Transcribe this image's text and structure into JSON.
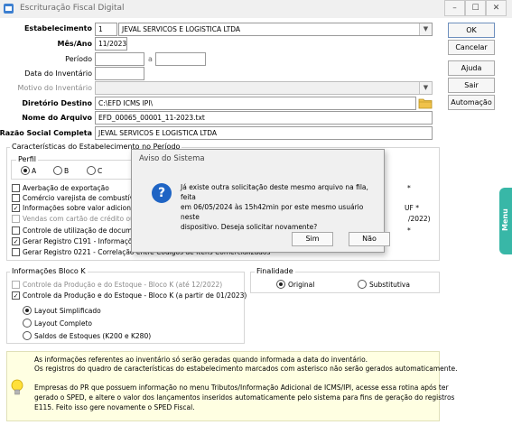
{
  "window": {
    "title": "Escrituração Fiscal Digital",
    "min_glyph": "–",
    "max_glyph": "☐",
    "close_glyph": "✕"
  },
  "form": {
    "estabelecimento": {
      "label": "Estabelecimento",
      "code": "1",
      "name": "JEVAL SERVICOS E LOGISTICA LTDA"
    },
    "mes_ano": {
      "label": "Mês/Ano",
      "value": "11/2023"
    },
    "periodo": {
      "label": "Período",
      "from": "",
      "separator": "a",
      "to": ""
    },
    "data_inventario": {
      "label": "Data do Inventário",
      "value": ""
    },
    "motivo_inventario": {
      "label": "Motivo do Inventário",
      "value": ""
    },
    "diretorio_destino": {
      "label": "Diretório Destino",
      "value": "C:\\EFD ICMS IPI\\"
    },
    "nome_arquivo": {
      "label": "Nome do Arquivo",
      "value": "EFD_00065_00001_11-2023.txt"
    },
    "razao_social": {
      "label": "Razão Social Completa",
      "value": "JEVAL SERVICOS E LOGISTICA LTDA"
    }
  },
  "buttons": {
    "ok": "OK",
    "cancelar": "Cancelar",
    "ajuda": "Ajuda",
    "sair": "Sair",
    "automacao": "Automação"
  },
  "caracteristicas": {
    "title": "Características do Estabelecimento no Período",
    "perfil": {
      "title": "Perfil",
      "options": [
        "A",
        "B",
        "C"
      ],
      "selected": "A"
    },
    "items": [
      {
        "label": "Averbação de exportação",
        "checked": false,
        "disabled": false
      },
      {
        "label": "Comércio varejista de combustíveis",
        "checked": false,
        "disabled": false
      },
      {
        "label": "Informações sobre valor adicionado",
        "checked": true,
        "disabled": false
      },
      {
        "label": "Vendas com cartão de crédito ou de",
        "checked": false,
        "disabled": true
      },
      {
        "label": "Controle de utilização de document",
        "checked": false,
        "disabled": false
      },
      {
        "label": "Gerar Registro C191 - Informações",
        "checked": true,
        "disabled": false
      },
      {
        "label": "Gerar Registro 0221 - Correlação entre Códigos de Itens Comercializados",
        "checked": false,
        "disabled": false
      }
    ],
    "right_fragments": {
      "f1": "*",
      "f2": "UF *",
      "f3": "/2022)",
      "f4": "*"
    }
  },
  "bloco_k": {
    "title": "Informações Bloco K",
    "items": [
      {
        "label": "Controle da Produção e do Estoque - Bloco K (até 12/2022)",
        "checked": false,
        "disabled": true
      },
      {
        "label": "Controle da Produção e do Estoque - Bloco K (a partir de 01/2023)",
        "checked": true,
        "disabled": false
      }
    ],
    "layouts": [
      "Layout Simplificado",
      "Layout Completo",
      "Saldos de Estoques (K200 e K280)"
    ],
    "selected_layout": "Layout Simplificado"
  },
  "finalidade": {
    "title": "Finalidade",
    "options": [
      "Original",
      "Substitutiva"
    ],
    "selected": "Original"
  },
  "info_box": {
    "lines": [
      "As informações referentes ao inventário só serão geradas quando informada a data do inventário.",
      "Os registros do quadro de características do estabelecimento marcados com asterisco não serão gerados automaticamente.",
      "Empresas do PR que possuem informação no menu Tributos/Informação Adicional de ICMS/IPI, acesse essa rotina após ter",
      "gerado o SPED, e altere o valor dos lançamentos inseridos automaticamente pelo sistema para fins de geração do registros",
      "E115. Feito isso gere novamente o SPED Fiscal."
    ]
  },
  "dialog": {
    "title": "Aviso do Sistema",
    "icon_glyph": "?",
    "message_lines": [
      "Já existe outra solicitação deste mesmo arquivo na fila, feita",
      "em 06/05/2024 às 15h42min por este mesmo usuário neste",
      "dispositivo. Deseja solicitar novamente?"
    ],
    "yes": "Sim",
    "no": "Não"
  },
  "side_tab": {
    "label": "Menu"
  },
  "colors": {
    "side_tab": "#38b7a7",
    "info_bg": "#ffffe2",
    "question_icon": "#1f64c4"
  }
}
